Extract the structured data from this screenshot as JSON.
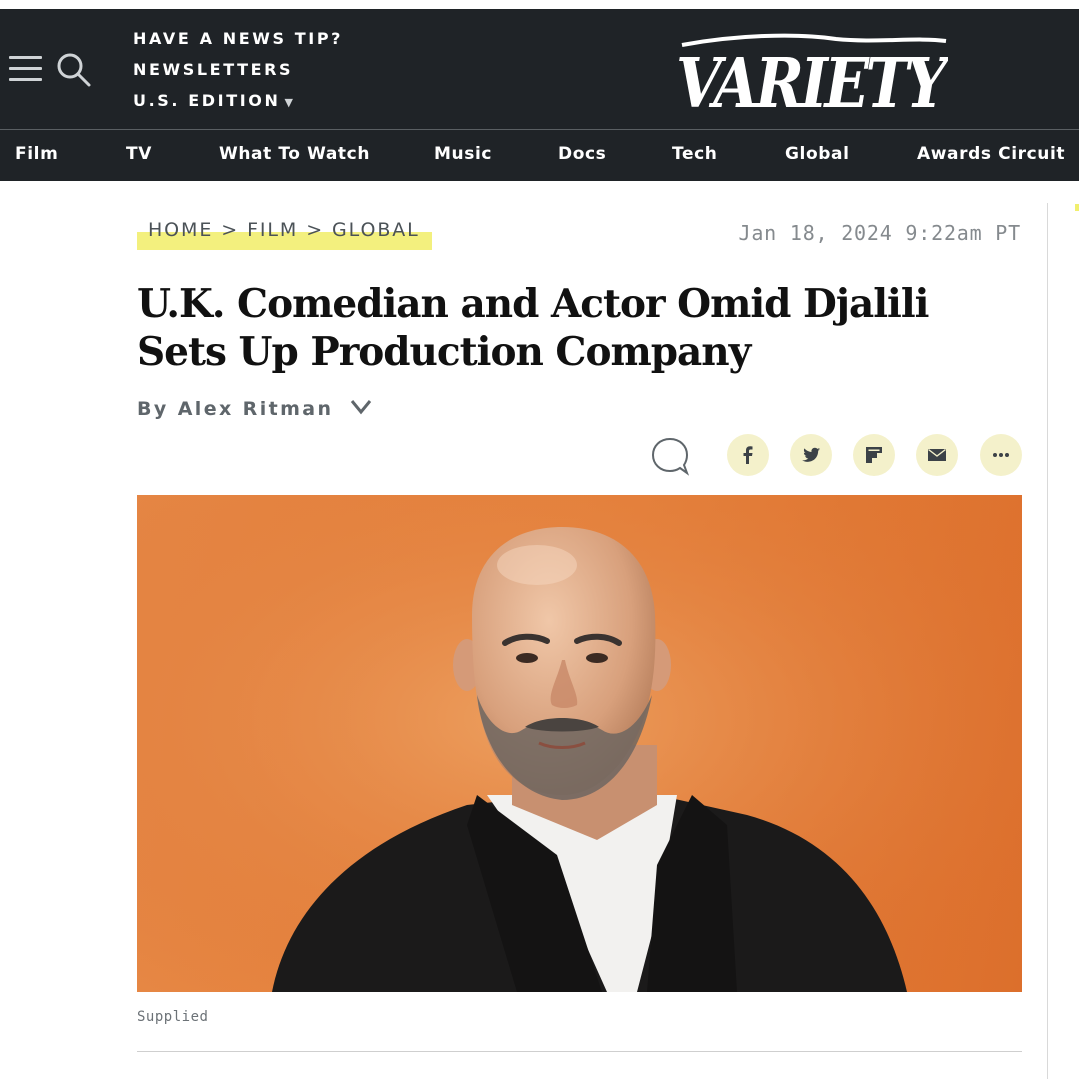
{
  "header": {
    "news_tip": "HAVE A NEWS TIP?",
    "newsletters": "NEWSLETTERS",
    "edition": "U.S. EDITION",
    "edition_caret": "▼",
    "logo_text": "VARIETY"
  },
  "nav": {
    "items": [
      {
        "label": "Film"
      },
      {
        "label": "TV"
      },
      {
        "label": "What To Watch"
      },
      {
        "label": "Music"
      },
      {
        "label": "Docs"
      },
      {
        "label": "Tech"
      },
      {
        "label": "Global"
      },
      {
        "label": "Awards Circuit"
      }
    ]
  },
  "breadcrumb": {
    "home": "HOME",
    "film": "FILM",
    "global": "GLOBAL",
    "separator": ">"
  },
  "article": {
    "date": "Jan 18, 2024 9:22am PT",
    "title": "U.K. Comedian and Actor Omid Djalili Sets Up Production Company",
    "byline_prefix": "By",
    "author": "Alex Ritman",
    "image_caption": "Supplied"
  },
  "share": {
    "icons": [
      "comment-icon",
      "facebook-icon",
      "twitter-icon",
      "flipboard-icon",
      "email-icon",
      "more-icon"
    ]
  },
  "colors": {
    "header_bg": "#1f2327",
    "highlight": "#f3f07e",
    "share_bg": "#f4f1cb",
    "hero_bg": "#e6843f"
  }
}
